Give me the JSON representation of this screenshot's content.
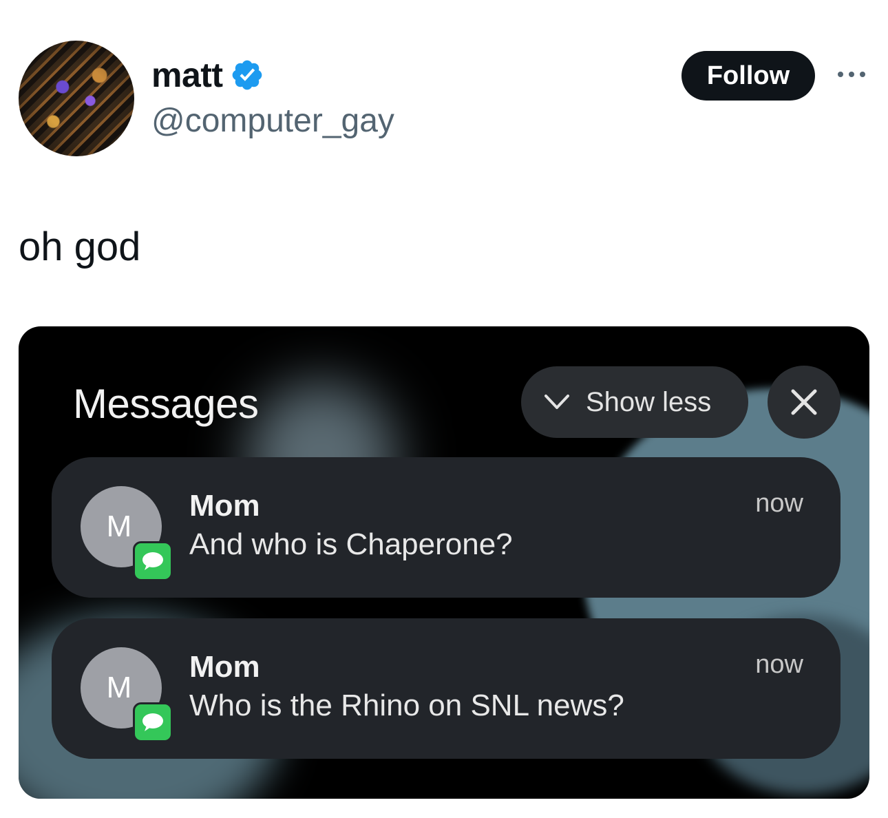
{
  "author": {
    "display_name": "matt",
    "handle": "@computer_gay",
    "verified": true
  },
  "actions": {
    "follow_label": "Follow"
  },
  "tweet": {
    "text": "oh god"
  },
  "colors": {
    "follow_bg": "#0f1419",
    "verified_blue": "#1d9bf0",
    "handle_gray": "#536471",
    "imessage_green": "#34c759"
  },
  "screenshot": {
    "app_header": "Messages",
    "show_less_label": "Show less",
    "notifications": [
      {
        "avatar_letter": "M",
        "sender": "Mom",
        "body": "And who is Chaperone?",
        "time": "now"
      },
      {
        "avatar_letter": "M",
        "sender": "Mom",
        "body": "Who is the Rhino on SNL news?",
        "time": "now"
      }
    ]
  }
}
